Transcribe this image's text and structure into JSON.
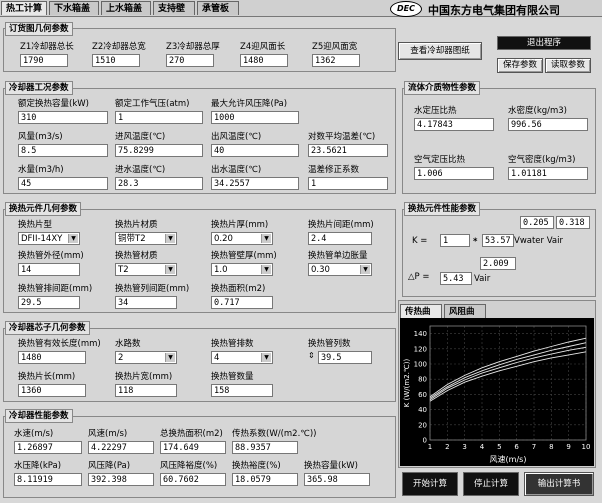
{
  "tabs": [
    "热工计算",
    "下水箱盖",
    "上水箱盖",
    "支持壁",
    "承管板"
  ],
  "logo": "DEC",
  "company": "中国东方电气集团有限公司",
  "buttons": {
    "view_drawing": "查看冷却器图纸",
    "exit": "退出程序",
    "save_params": "保存参数",
    "read_params": "读取参数",
    "start_calc": "开始计算",
    "stop_calc": "停止计算",
    "output_doc": "输出计算书"
  },
  "cooler_geometry": {
    "title": "订货图几何参数",
    "fields": [
      {
        "label": "Z1冷却器总长",
        "value": "1790"
      },
      {
        "label": "Z2冷却器总宽",
        "value": "1510"
      },
      {
        "label": "Z3冷却器总厚",
        "value": "270"
      },
      {
        "label": "Z4迎风面长",
        "value": "1480"
      },
      {
        "label": "Z5迎风面宽",
        "value": "1362"
      }
    ]
  },
  "working_params": {
    "title": "冷却器工况参数",
    "fields": [
      {
        "label": "额定换热容量(kW)",
        "value": "310"
      },
      {
        "label": "额定工作气压(atm)",
        "value": "1"
      },
      {
        "label": "最大允许风压降(Pa)",
        "value": "1000"
      },
      {
        "label": "风量(m3/s)",
        "value": "8.5"
      },
      {
        "label": "进风温度(℃)",
        "value": "75.8299"
      },
      {
        "label": "出风温度(℃)",
        "value": "40"
      },
      {
        "label": "对数平均温差(℃)",
        "value": "23.5621"
      },
      {
        "label": "水量(m3/h)",
        "value": "45"
      },
      {
        "label": "进水温度(℃)",
        "value": "28.3"
      },
      {
        "label": "出水温度(℃)",
        "value": "34.2557"
      },
      {
        "label": "温差修正系数",
        "value": "1"
      }
    ]
  },
  "fluid_props": {
    "title": "流体介质物性参数",
    "fields": [
      {
        "label": "水定压比热",
        "value": "4.17843"
      },
      {
        "label": "水密度(kg/m3)",
        "value": "996.56"
      },
      {
        "label": "空气定压比热",
        "value": "1.006"
      },
      {
        "label": "空气密度(kg/m3)",
        "value": "1.01181"
      }
    ]
  },
  "element_geometry": {
    "title": "换热元件几何参数",
    "fields": [
      {
        "label": "换热片型",
        "value": "DFII-14XY",
        "type": "select"
      },
      {
        "label": "换热片材质",
        "value": "铜带T2",
        "type": "select"
      },
      {
        "label": "换热片厚(mm)",
        "value": "0.20",
        "type": "select"
      },
      {
        "label": "换热片间距(mm)",
        "value": "2.4",
        "type": "box"
      },
      {
        "label": "换热管外径(mm)",
        "value": "14",
        "type": "box"
      },
      {
        "label": "换热管材质",
        "value": "T2",
        "type": "select"
      },
      {
        "label": "换热管壁厚(mm)",
        "value": "1.0",
        "type": "select"
      },
      {
        "label": "换热管单边胀量",
        "value": "0.30",
        "type": "select"
      },
      {
        "label": "换热管排间距(mm)",
        "value": "29.5",
        "type": "box"
      },
      {
        "label": "换热管列间距(mm)",
        "value": "34",
        "type": "box"
      },
      {
        "label": "换热面积(m2)",
        "value": "0.717",
        "type": "box"
      }
    ]
  },
  "performance": {
    "title": "换热元件性能参数",
    "k_label": "K =",
    "k_coef": "1",
    "k_mult": "53.57",
    "k_exp1": "0.205",
    "k_exp2": "0.318",
    "k_vars": "Vwater Vair",
    "p_label": "△P =",
    "p_coef": "5.43",
    "p_exp": "2.009",
    "p_var": "Vair"
  },
  "core_geometry": {
    "title": "冷却器芯子几何参数",
    "fields": [
      {
        "label": "换热管有效长度(mm)",
        "value": "1480",
        "type": "box"
      },
      {
        "label": "水路数",
        "value": "2",
        "type": "select"
      },
      {
        "label": "换热管排数",
        "value": "4",
        "type": "select"
      },
      {
        "label": "换热管列数",
        "value": "39.5",
        "type": "box"
      },
      {
        "label": "换热片长(mm)",
        "value": "1360",
        "type": "box"
      },
      {
        "label": "换热片宽(mm)",
        "value": "118",
        "type": "box"
      },
      {
        "label": "换热管数量",
        "value": "158",
        "type": "box"
      }
    ]
  },
  "performance_results": {
    "title": "冷却器性能参数",
    "fields": [
      {
        "label": "水速(m/s)",
        "value": "1.26897"
      },
      {
        "label": "风速(m/s)",
        "value": "4.22297"
      },
      {
        "label": "总换热面积(m2)",
        "value": "174.649"
      },
      {
        "label": "传热系数(W/(m2.℃))",
        "value": "88.9357"
      },
      {
        "label": "水压降(kPa)",
        "value": "8.11919"
      },
      {
        "label": "风压降(Pa)",
        "value": "392.398"
      },
      {
        "label": "风压降裕度(%)",
        "value": "60.7602"
      },
      {
        "label": "换热裕度(%)",
        "value": "18.0579"
      },
      {
        "label": "换热容量(kW)",
        "value": "365.98"
      }
    ]
  },
  "chart_tabs": [
    "传热曲线",
    "风阻曲线"
  ],
  "chart_data": {
    "type": "line",
    "xlabel": "风速(m/s)",
    "ylabel": "K (W/(m2.℃))",
    "x_ticks": [
      "1",
      "2",
      "3",
      "4",
      "5",
      "6",
      "7",
      "8",
      "9",
      "10"
    ],
    "y_ticks": [
      "0",
      "20",
      "40",
      "60",
      "80",
      "100",
      "120",
      "140"
    ],
    "xlim": [
      1,
      10
    ],
    "ylim": [
      0,
      150
    ],
    "grid": true,
    "series": [
      {
        "x": [
          1,
          2,
          3,
          4,
          5,
          6,
          7,
          8,
          9,
          10
        ],
        "values": [
          57,
          73,
          85,
          95,
          103,
          110,
          117,
          123,
          129,
          134
        ]
      },
      {
        "x": [
          1,
          2,
          3,
          4,
          5,
          6,
          7,
          8,
          9,
          10
        ],
        "values": [
          55,
          70,
          82,
          91,
          99,
          106,
          112,
          118,
          123,
          128
        ]
      },
      {
        "x": [
          1,
          2,
          3,
          4,
          5,
          6,
          7,
          8,
          9,
          10
        ],
        "values": [
          53,
          68,
          79,
          88,
          95,
          102,
          108,
          113,
          118,
          122
        ]
      },
      {
        "x": [
          1,
          2,
          3,
          4,
          5,
          6,
          7,
          8,
          9,
          10
        ],
        "values": [
          51,
          65,
          76,
          84,
          91,
          97,
          103,
          108,
          112,
          116
        ]
      }
    ]
  }
}
